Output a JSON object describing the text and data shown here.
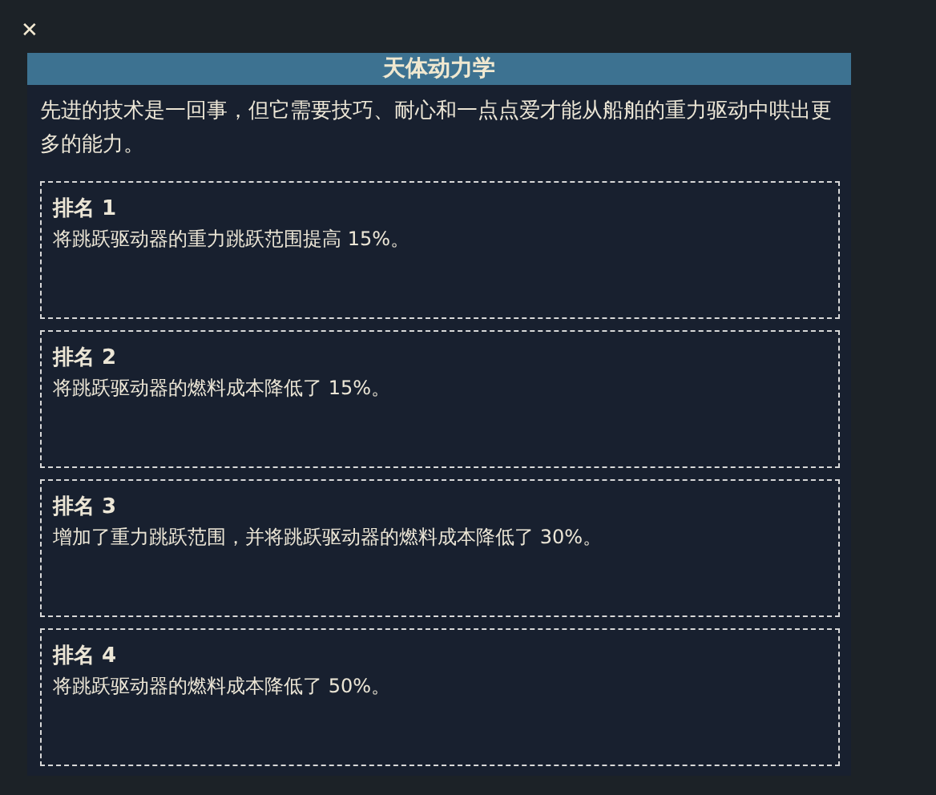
{
  "close_button": "✕",
  "panel": {
    "title": "天体动力学",
    "description": "先进的技术是一回事，但它需要技巧、耐心和一点点爱才能从船舶的重力驱动中哄出更多的能力。",
    "ranks": [
      {
        "title": "排名 1",
        "effect": "将跳跃驱动器的重力跳跃范围提高 15%。"
      },
      {
        "title": "排名 2",
        "effect": "将跳跃驱动器的燃料成本降低了 15%。"
      },
      {
        "title": "排名 3",
        "effect": "增加了重力跳跃范围，并将跳跃驱动器的燃料成本降低了 30%。"
      },
      {
        "title": "排名 4",
        "effect": "将跳跃驱动器的燃料成本降低了 50%。"
      }
    ]
  }
}
